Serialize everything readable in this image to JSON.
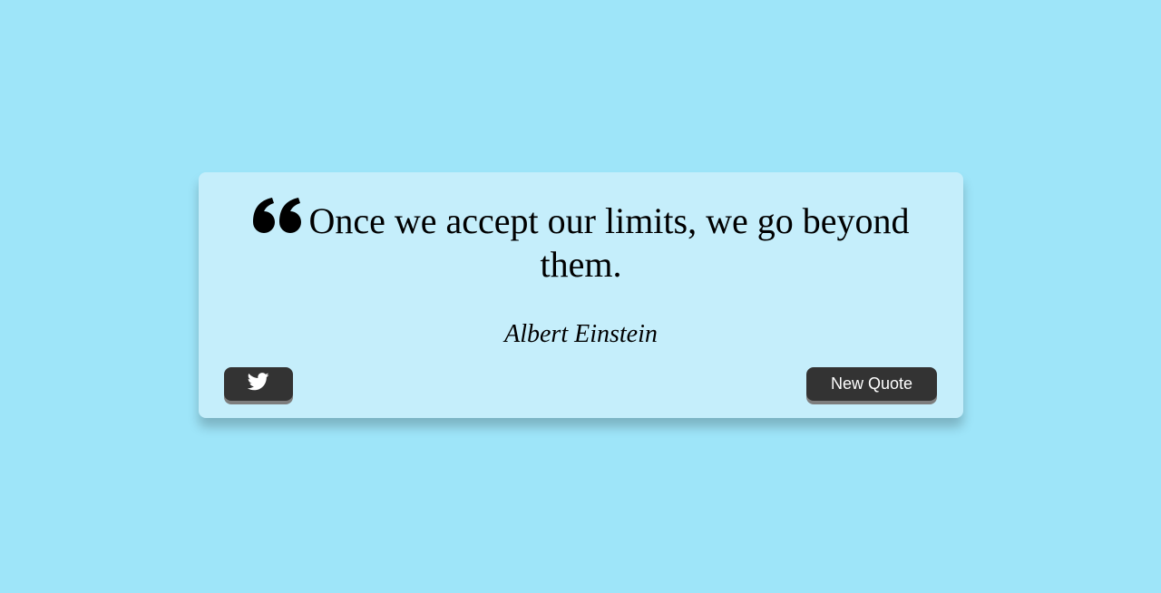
{
  "quote": {
    "text": "Once we accept our limits, we go beyond them.",
    "author": "Albert Einstein",
    "icon": "quote-left-icon"
  },
  "actions": {
    "tweet_icon": "twitter-icon",
    "new_quote_label": "New Quote"
  },
  "colors": {
    "background": "#9ee5f9",
    "card": "#c5eefb",
    "button": "#333333",
    "button_text": "#ffffff"
  }
}
